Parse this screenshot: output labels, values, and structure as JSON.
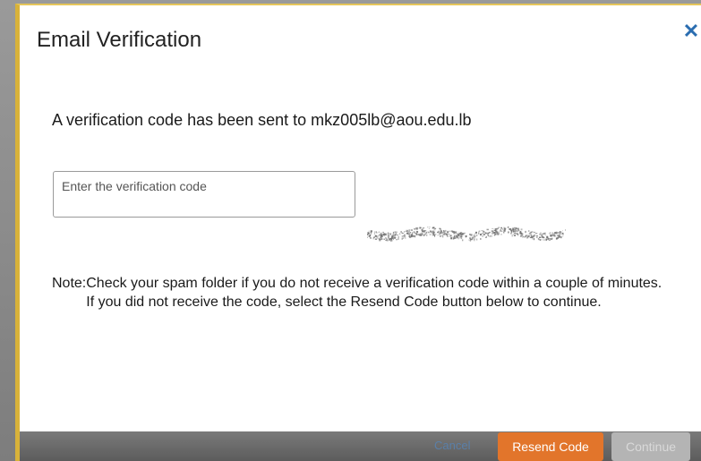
{
  "dialog": {
    "title": "Email Verification",
    "close_symbol": "✕",
    "message": "A verification code has been sent to mkz005lb@aou.edu.lb",
    "code_input": {
      "value": "",
      "placeholder": "Enter the verification code"
    },
    "note": {
      "label": "Note:",
      "lines": [
        "Check your spam folder if you do not receive a verification code within a couple of minutes.",
        "If you did not receive the code, select the Resend Code button below to continue."
      ]
    }
  },
  "footer": {
    "cancel_label": "Cancel",
    "resend_label": "Resend Code",
    "continue_label": "Continue"
  },
  "colors": {
    "accent_orange": "#e2752b",
    "close_blue": "#2a6db0",
    "modal_border": "#d8b23a",
    "disabled_gray": "#b4b4b4"
  },
  "icons": {
    "close": "close-icon"
  }
}
